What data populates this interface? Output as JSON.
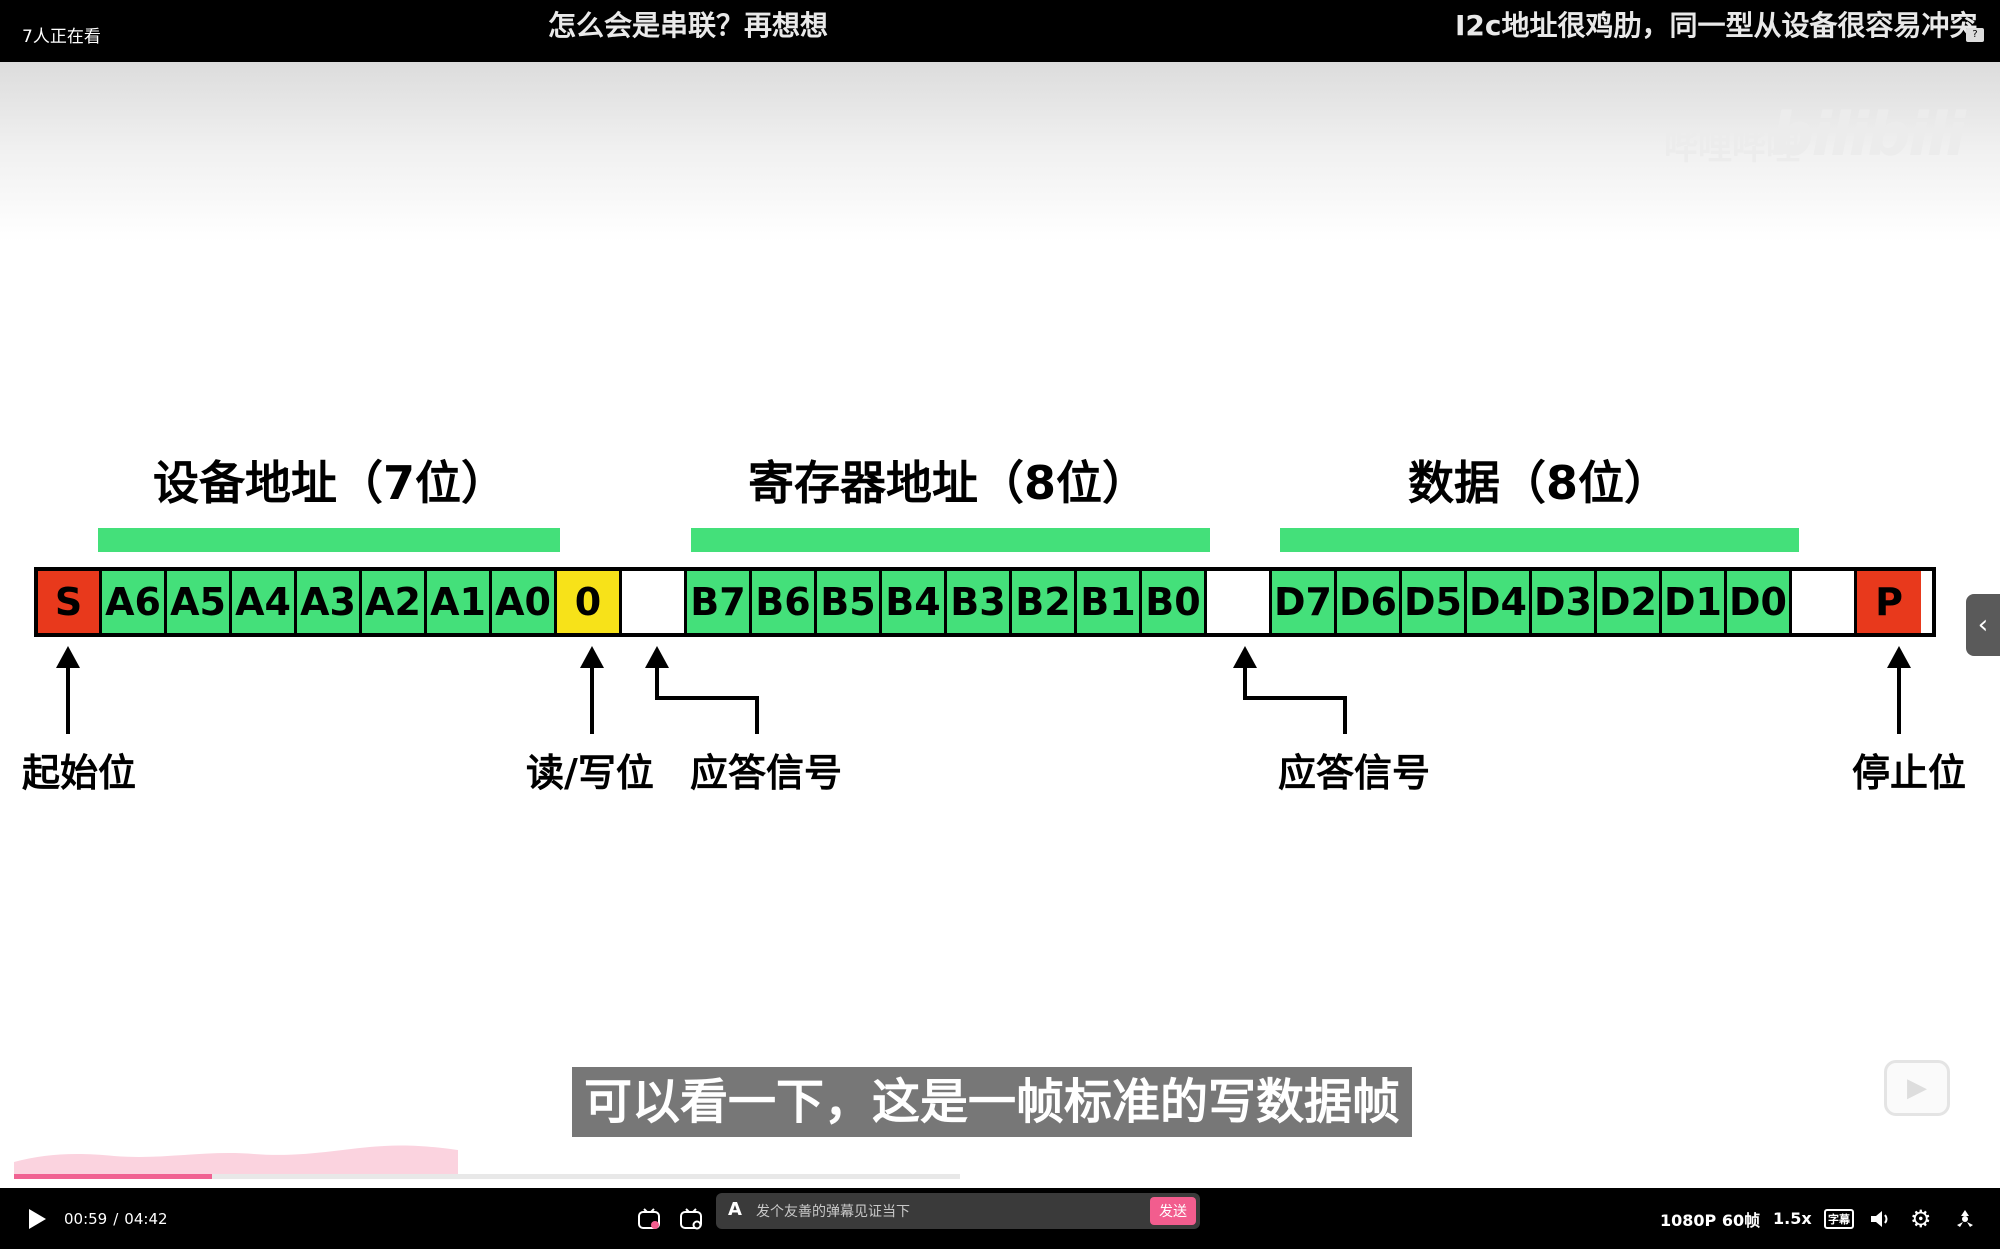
{
  "topbar": {
    "viewers": "7人正在看",
    "danmaku": [
      "怎么会是串联？再想想",
      "I2c地址很鸡肋，同一型从设备很容易冲突"
    ],
    "corner_badge": "?"
  },
  "video": {
    "watermark": "bilibili",
    "watermark_sub": "哔哩哔哩",
    "group_titles": {
      "device_address": "设备地址（7位）",
      "register_address": "寄存器地址（8位）",
      "data": "数据（8位）"
    },
    "frame_cells": [
      "S",
      "A6",
      "A5",
      "A4",
      "A3",
      "A2",
      "A1",
      "A0",
      "0",
      "",
      "B7",
      "B6",
      "B5",
      "B4",
      "B3",
      "B2",
      "B1",
      "B0",
      "",
      "D7",
      "D6",
      "D5",
      "D4",
      "D3",
      "D2",
      "D1",
      "D0",
      "",
      "P"
    ],
    "cell_colors": {
      "red": "#e8391c",
      "green": "#44e07a",
      "yellow": "#f7e219",
      "white": "#ffffff"
    },
    "signals": {
      "start": "起始位",
      "rw": "读/写位",
      "ack1": "应答信号",
      "ack2": "应答信号",
      "stop": "停止位"
    },
    "subtitle": "可以看一下，这是一帧标准的写数据帧",
    "progress": 0.209
  },
  "controls": {
    "current_time": "00:59",
    "separator": "/",
    "total_time": "04:42",
    "danmaku_placeholder": "发个友善的弹幕见证当下",
    "send_label": "发送",
    "quality": "1080P 60帧",
    "speed": "1.5x",
    "cc": "字幕",
    "accent": "#f25d8e"
  }
}
